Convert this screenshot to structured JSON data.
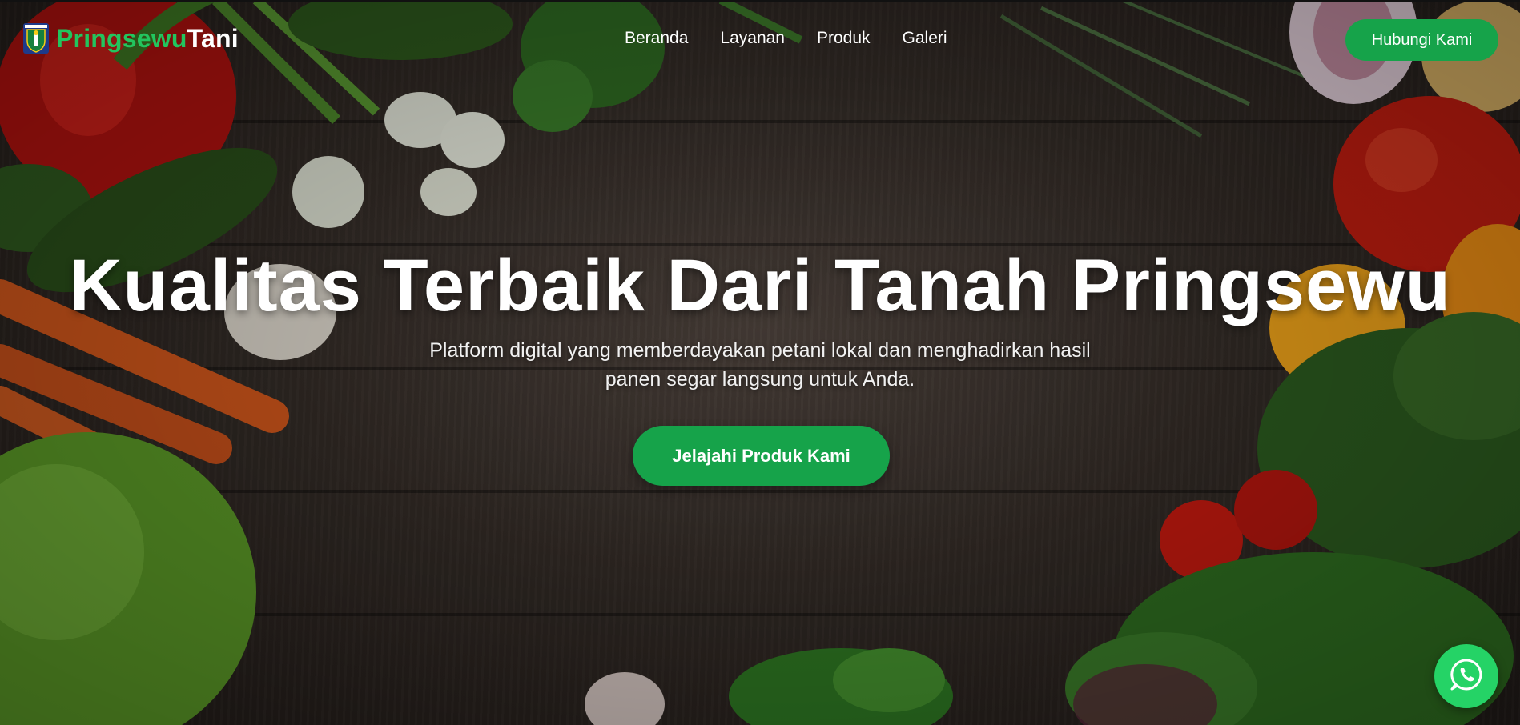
{
  "brand": {
    "name_part1": "Pringsewu",
    "name_part2": "Tani",
    "logo_icon": "regency-crest-icon"
  },
  "nav": {
    "links": [
      {
        "label": "Beranda"
      },
      {
        "label": "Layanan"
      },
      {
        "label": "Produk"
      },
      {
        "label": "Galeri"
      }
    ],
    "contact_button": "Hubungi Kami"
  },
  "hero": {
    "title": "Kualitas Terbaik Dari Tanah Pringsewu",
    "subtitle_line1": "Platform digital yang memberdayakan petani lokal dan menghadirkan hasil",
    "subtitle_line2": "panen segar langsung untuk Anda.",
    "cta_label": "Jelajahi Produk Kami",
    "background": "dark wooden table with fresh vegetables"
  },
  "floating": {
    "whatsapp_icon": "whatsapp-icon"
  },
  "colors": {
    "accent": "#16a34a",
    "brand_green": "#22c55e",
    "whatsapp": "#25d366"
  }
}
